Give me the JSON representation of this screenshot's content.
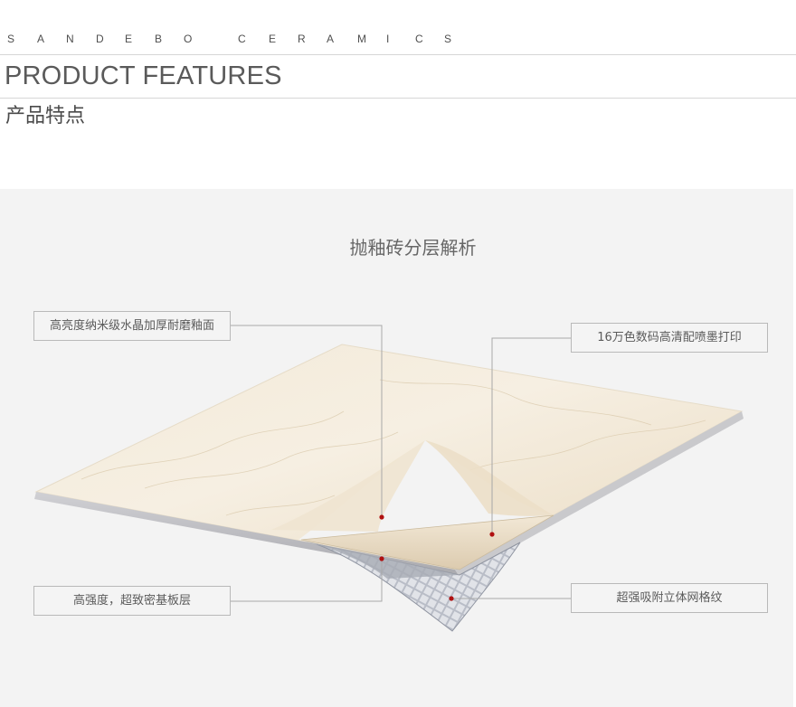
{
  "header": {
    "brand_letters": [
      "S",
      "A",
      "N",
      "D",
      "E",
      "B",
      "O",
      "C",
      "E",
      "R",
      "A",
      "M",
      "I",
      "C",
      "S"
    ],
    "title_en": "PRODUCT FEATURES",
    "title_cn": "产品特点"
  },
  "section": {
    "title": "抛釉砖分层解析"
  },
  "callouts": {
    "top_left": "高亮度纳米级水晶加厚耐磨釉面",
    "top_right": "16万色数码高清配喷墨打印",
    "bottom_left": "高强度，超致密基板层",
    "bottom_right": "超强吸附立体网格纹"
  },
  "colors": {
    "panel_bg": "#f3f3f3",
    "tile_surface": "#efe3cf",
    "tile_edge": "#b8b8bc",
    "mesh_layer": "#9aa0ad",
    "marker_dot": "#b01010",
    "leader_line": "#a8a8a8"
  }
}
